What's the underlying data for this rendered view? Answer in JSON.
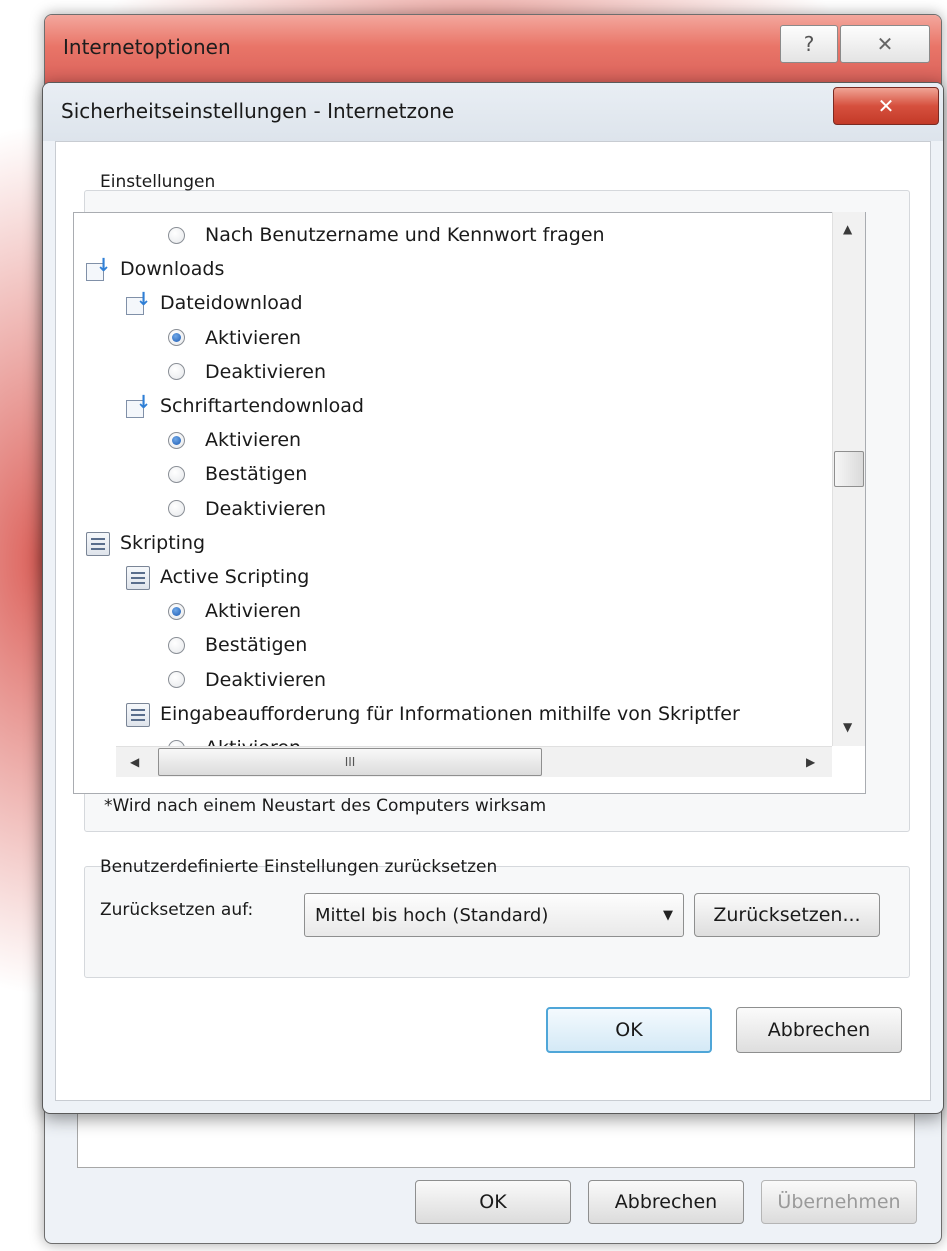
{
  "back_window": {
    "title": "Internetoptionen",
    "help_icon": "question-icon",
    "close_icon": "close-x-icon",
    "buttons": {
      "ok": "OK",
      "cancel": "Abbrechen",
      "apply": "Übernehmen"
    }
  },
  "dialog": {
    "title": "Sicherheitseinstellungen - Internetzone",
    "close_icon": "close-x-icon",
    "settings_group_label": "Einstellungen",
    "tree_items": [
      {
        "kind": "radio",
        "label": "Nach Benutzername und Kennwort fragen",
        "checked": false,
        "indent": 2
      },
      {
        "kind": "node",
        "icon": "download-icon",
        "label": "Downloads",
        "indent": 0
      },
      {
        "kind": "node",
        "icon": "download-icon",
        "label": "Dateidownload",
        "indent": 1
      },
      {
        "kind": "radio",
        "label": "Aktivieren",
        "checked": true,
        "indent": 2
      },
      {
        "kind": "radio",
        "label": "Deaktivieren",
        "checked": false,
        "indent": 2
      },
      {
        "kind": "node",
        "icon": "download-icon",
        "label": "Schriftartendownload",
        "indent": 1
      },
      {
        "kind": "radio",
        "label": "Aktivieren",
        "checked": true,
        "indent": 2
      },
      {
        "kind": "radio",
        "label": "Bestätigen",
        "checked": false,
        "indent": 2
      },
      {
        "kind": "radio",
        "label": "Deaktivieren",
        "checked": false,
        "indent": 2
      },
      {
        "kind": "node",
        "icon": "script-icon",
        "label": "Skripting",
        "indent": 0
      },
      {
        "kind": "node",
        "icon": "script-icon",
        "label": "Active Scripting",
        "indent": 1
      },
      {
        "kind": "radio",
        "label": "Aktivieren",
        "checked": true,
        "indent": 2
      },
      {
        "kind": "radio",
        "label": "Bestätigen",
        "checked": false,
        "indent": 2
      },
      {
        "kind": "radio",
        "label": "Deaktivieren",
        "checked": false,
        "indent": 2
      },
      {
        "kind": "node",
        "icon": "script-icon",
        "label": "Eingabeaufforderung für Informationen mithilfe von Skriptfer",
        "indent": 1
      },
      {
        "kind": "radio",
        "label": "Aktivieren",
        "checked": false,
        "indent": 2
      }
    ],
    "hscroll_thumb_glyph": "III",
    "note": "*Wird nach einem Neustart des Computers wirksam",
    "reset_group_label": "Benutzerdefinierte Einstellungen zurücksetzen",
    "reset_to_label": "Zurücksetzen auf:",
    "reset_level_value": "Mittel bis hoch (Standard)",
    "reset_button": "Zurücksetzen...",
    "ok_button": "OK",
    "cancel_button": "Abbrechen"
  }
}
